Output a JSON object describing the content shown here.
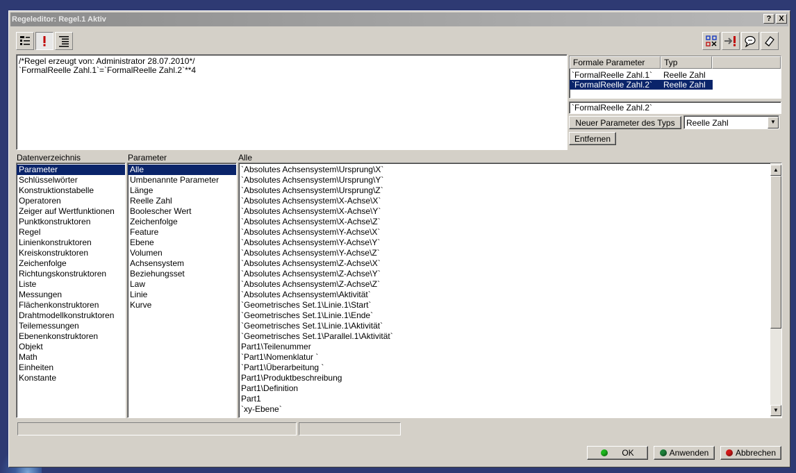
{
  "window": {
    "title": "Regeleditor: Regel.1 Aktiv",
    "help_label": "?",
    "close_label": "X"
  },
  "editor": {
    "lines": [
      "/*Regel erzeugt von: Administrator 28.07.2010*/",
      "`FormalReelle Zahl.1`=`FormalReelle Zahl.2`**4"
    ]
  },
  "formal_params": {
    "col_name": "Formale Parameter",
    "col_type": "Typ",
    "rows": [
      {
        "name": "`FormalReelle Zahl.1`",
        "type": "Reelle Zahl",
        "selected": false
      },
      {
        "name": "`FormalReelle Zahl.2`",
        "type": "Reelle Zahl",
        "selected": true
      }
    ],
    "current_value": "`FormalReelle Zahl.2`",
    "new_param_label": "Neuer Parameter des Typs",
    "type_value": "Reelle Zahl",
    "remove_label": "Entfernen"
  },
  "lists": {
    "dir_label": "Datenverzeichnis",
    "param_label": "Parameter",
    "all_label": "Alle",
    "dir_items": [
      "Parameter",
      "Schlüsselwörter",
      "Konstruktionstabelle",
      "Operatoren",
      "Zeiger auf Wertfunktionen",
      "Punktkonstruktoren",
      "Regel",
      "Linienkonstruktoren",
      "Kreiskonstruktoren",
      "Zeichenfolge",
      "Richtungskonstruktoren",
      "Liste",
      "Messungen",
      "Flächenkonstruktoren",
      "Drahtmodellkonstruktoren",
      "Teilemessungen",
      "Ebenenkonstruktoren",
      "Objekt",
      "Math",
      "Einheiten",
      "Konstante"
    ],
    "param_items": [
      "Alle",
      "Umbenannte Parameter",
      "Länge",
      "Reelle Zahl",
      "Boolescher Wert",
      "Zeichenfolge",
      "Feature",
      "Ebene",
      "Volumen",
      "Achsensystem",
      "Beziehungsset",
      "Law",
      "Linie",
      "Kurve"
    ],
    "all_items": [
      "`Absolutes Achsensystem\\Ursprung\\X`",
      "`Absolutes Achsensystem\\Ursprung\\Y`",
      "`Absolutes Achsensystem\\Ursprung\\Z`",
      "`Absolutes Achsensystem\\X-Achse\\X`",
      "`Absolutes Achsensystem\\X-Achse\\Y`",
      "`Absolutes Achsensystem\\X-Achse\\Z`",
      "`Absolutes Achsensystem\\Y-Achse\\X`",
      "`Absolutes Achsensystem\\Y-Achse\\Y`",
      "`Absolutes Achsensystem\\Y-Achse\\Z`",
      "`Absolutes Achsensystem\\Z-Achse\\X`",
      "`Absolutes Achsensystem\\Z-Achse\\Y`",
      "`Absolutes Achsensystem\\Z-Achse\\Z`",
      "`Absolutes Achsensystem\\Aktivität`",
      "`Geometrisches Set.1\\Linie.1\\Start`",
      "`Geometrisches Set.1\\Linie.1\\Ende`",
      "`Geometrisches Set.1\\Linie.1\\Aktivität`",
      "`Geometrisches Set.1\\Parallel.1\\Aktivität`",
      "Part1\\Teilenummer",
      "`Part1\\Nomenklatur `",
      "`Part1\\Überarbeitung `",
      "Part1\\Produktbeschreibung",
      "Part1\\Definition",
      "Part1",
      "`xy-Ebene`"
    ]
  },
  "footer": {
    "ok_label": "OK",
    "apply_label": "Anwenden",
    "cancel_label": "Abbrechen"
  },
  "colors": {
    "selection": "#0a246a",
    "ok_dot": "#1db51d",
    "apply_dot": "#1d7f3a",
    "cancel_dot": "#d01818"
  },
  "icons": [
    "rule-tree-icon",
    "exclamation-icon",
    "indent-icon",
    "pick-parameter-icon",
    "arrow-exclamation-icon",
    "speech-bubble-icon",
    "eraser-icon"
  ]
}
